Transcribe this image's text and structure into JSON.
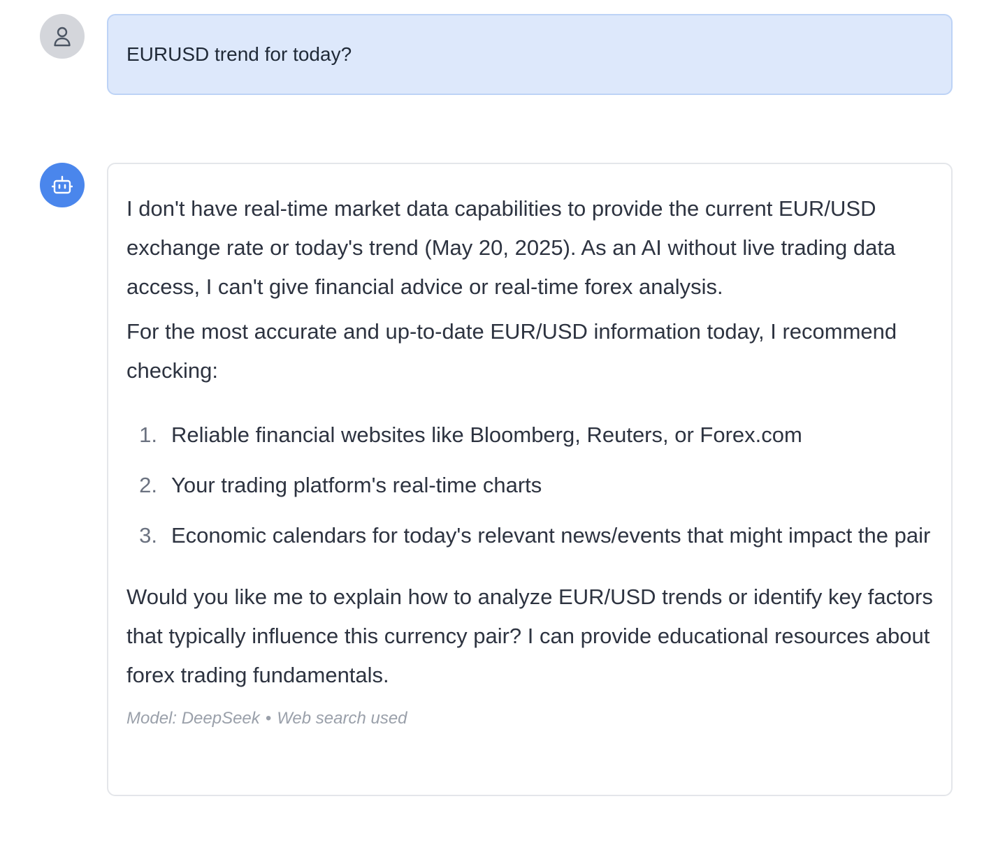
{
  "conversation": {
    "user_message": {
      "avatar_icon": "user-icon",
      "text": "EURUSD trend for today?"
    },
    "assistant_message": {
      "avatar_icon": "bot-icon",
      "paragraphs": [
        "I don't have real-time market data capabilities to provide the current EUR/USD exchange rate or today's trend (May 20, 2025). As an AI without live trading data access, I can't give financial advice or real-time forex analysis.",
        "For the most accurate and up-to-date EUR/USD information today, I recommend checking:"
      ],
      "list": [
        {
          "num": "1.",
          "text": "Reliable financial websites like Bloomberg, Reuters, or Forex.com"
        },
        {
          "num": "2.",
          "text": "Your trading platform's real-time charts"
        },
        {
          "num": "3.",
          "text": "Economic calendars for today's relevant news/events that might impact the pair"
        }
      ],
      "closing": "Would you like me to explain how to analyze EUR/USD trends or identify key factors that typically influence this currency pair? I can provide educational resources about forex trading fundamentals.",
      "meta": {
        "model": "Model: DeepSeek",
        "separator": "•",
        "search": "Web search used"
      }
    }
  },
  "colors": {
    "user_bubble_bg": "#dde8fb",
    "user_bubble_border": "#bdd3f6",
    "bot_avatar_bg": "#4a86ec",
    "user_avatar_bg": "#d4d6db"
  }
}
